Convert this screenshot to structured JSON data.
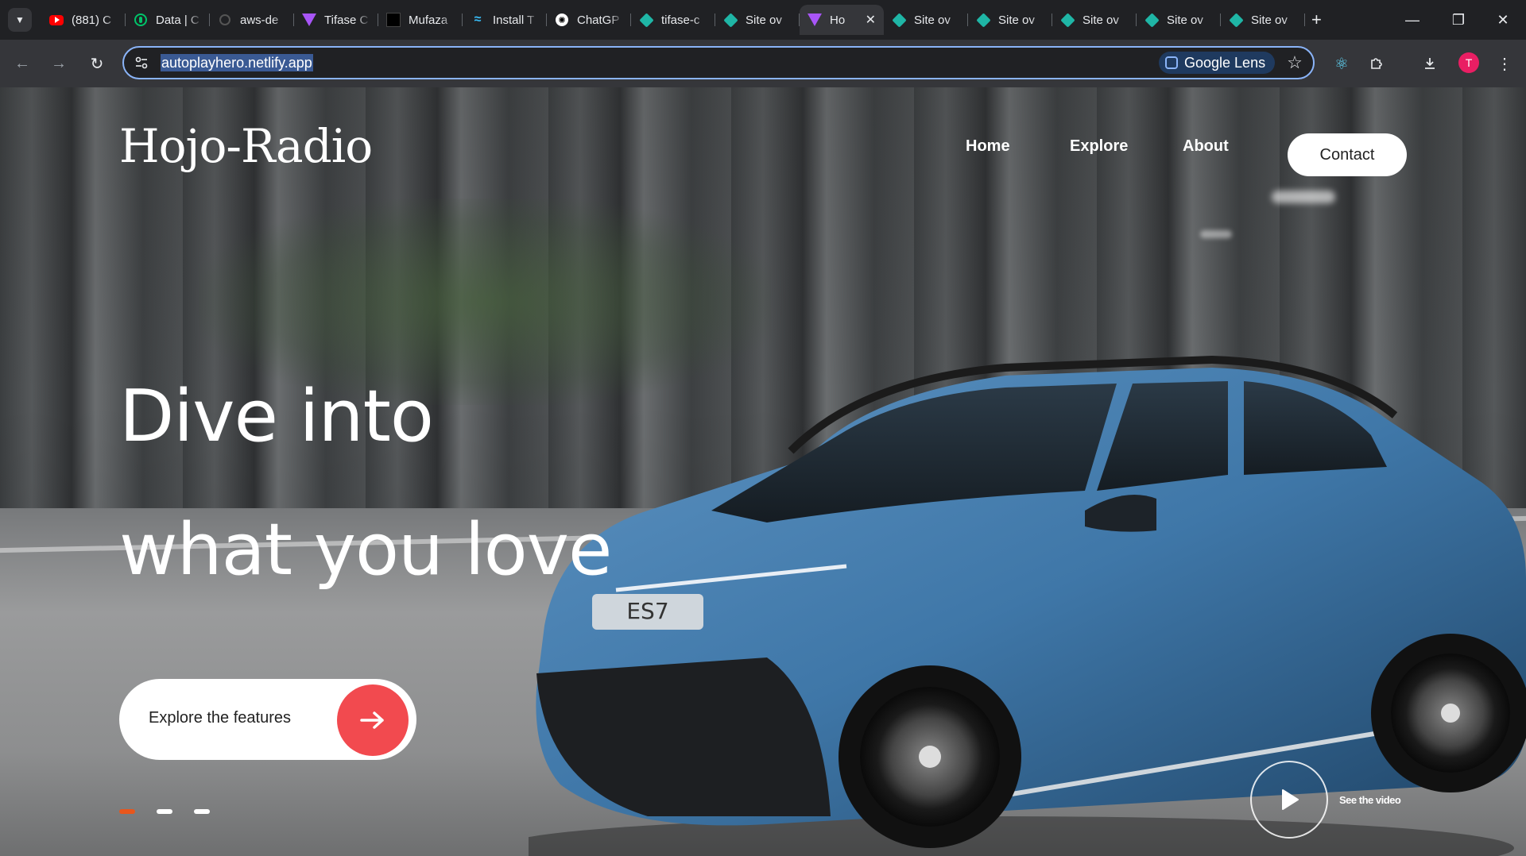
{
  "browser": {
    "tabs": [
      {
        "title": "(881) C",
        "icon": "youtube-icon"
      },
      {
        "title": "Data | C",
        "icon": "mongodb-icon"
      },
      {
        "title": "aws-de",
        "icon": "github-icon"
      },
      {
        "title": "Tifase C",
        "icon": "vite-icon"
      },
      {
        "title": "Mufaza",
        "icon": "dark-site-icon"
      },
      {
        "title": "Install T",
        "icon": "tailwind-icon"
      },
      {
        "title": "ChatGP",
        "icon": "chatgpt-icon"
      },
      {
        "title": "tifase-c",
        "icon": "netlify-icon"
      },
      {
        "title": "Site ov",
        "icon": "netlify-icon"
      },
      {
        "title": "Ho",
        "icon": "vite-icon",
        "active": true
      },
      {
        "title": "Site ov",
        "icon": "netlify-icon"
      },
      {
        "title": "Site ov",
        "icon": "netlify-icon"
      },
      {
        "title": "Site ov",
        "icon": "netlify-icon"
      },
      {
        "title": "Site ov",
        "icon": "netlify-icon"
      },
      {
        "title": "Site ov",
        "icon": "netlify-icon"
      }
    ],
    "url": "autoplayhero.netlify.app",
    "lens_label": "Google Lens",
    "profile_initial": "T"
  },
  "site": {
    "logo": "Hojo-Radio",
    "nav": {
      "home": "Home",
      "explore": "Explore",
      "about": "About",
      "contact": "Contact"
    },
    "headline_line1": "Dive into",
    "headline_line2": "what you love",
    "cta_label": "Explore the features",
    "video_label": "See the video",
    "car_plate": "ES7",
    "slides": {
      "count": 3,
      "active_index": 0
    }
  },
  "colors": {
    "accent_red": "#f24a4f",
    "active_dot": "#e8561c",
    "car_blue": "#3f77a8"
  }
}
